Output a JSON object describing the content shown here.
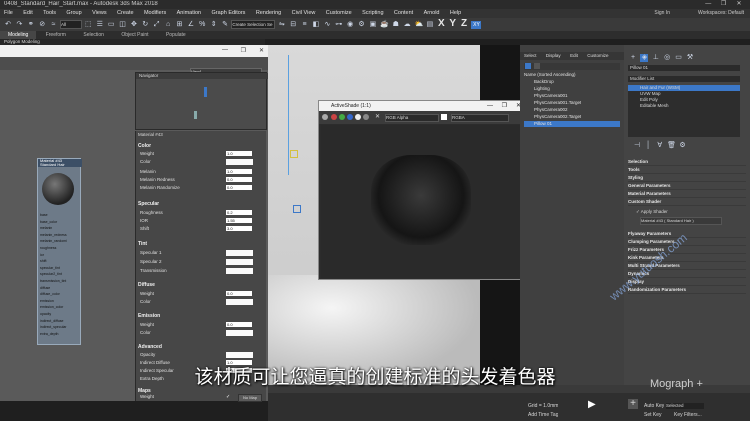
{
  "window": {
    "title": "0408_Standard_Hair_Start.max - Autodesk 3ds Max 2018",
    "buttons": [
      "—",
      "❐",
      "✕"
    ]
  },
  "menu": [
    "File",
    "Edit",
    "Tools",
    "Group",
    "Views",
    "Create",
    "Modifiers",
    "Animation",
    "Graph Editors",
    "Rendering",
    "Civil View",
    "Customize",
    "Scripting",
    "Content",
    "Arnold",
    "Help"
  ],
  "signin": "Sign In",
  "workspace": "Workspaces: Default",
  "toolbar": {
    "filter": "All",
    "selection_set": "Create Selection Se",
    "axes": [
      "X",
      "Y",
      "Z",
      "XY"
    ]
  },
  "ribbon": {
    "tabs": [
      "Modeling",
      "Freeform",
      "Selection",
      "Object Paint",
      "Populate"
    ],
    "sub": "Polygon Modeling"
  },
  "slate": {
    "view_select": "View1",
    "navigator": "Navigator",
    "panel_title": "Material #43",
    "groups": [
      {
        "name": "Color",
        "rows": [
          {
            "label": "Weight",
            "value": "1.0"
          },
          {
            "label": "Color",
            "value": ""
          },
          {
            "label": "Melanin",
            "value": "1.0"
          },
          {
            "label": "Melanin Redness",
            "value": "0.0"
          },
          {
            "label": "Melanin Randomize",
            "value": "0.0"
          }
        ]
      },
      {
        "name": "Specular",
        "rows": [
          {
            "label": "Roughness",
            "value": "0.2"
          },
          {
            "label": "IOR",
            "value": "1.55"
          },
          {
            "label": "Shift",
            "value": "3.0"
          }
        ]
      },
      {
        "name": "Tint",
        "rows": [
          {
            "label": "Specular 1",
            "value": ""
          },
          {
            "label": "Specular 2",
            "value": ""
          },
          {
            "label": "Transmission",
            "value": ""
          }
        ]
      },
      {
        "name": "Diffuse",
        "rows": [
          {
            "label": "Weight",
            "value": "0.0"
          },
          {
            "label": "Color",
            "value": ""
          }
        ]
      },
      {
        "name": "Emission",
        "rows": [
          {
            "label": "Weight",
            "value": "0.0"
          },
          {
            "label": "Color",
            "value": ""
          }
        ]
      },
      {
        "name": "Advanced",
        "rows": [
          {
            "label": "Opacity",
            "value": ""
          },
          {
            "label": "Indirect Diffuse",
            "value": "1.0"
          },
          {
            "label": "Indirect Specular",
            "value": "1.0"
          },
          {
            "label": "Extra Depth",
            "value": ""
          }
        ]
      },
      {
        "name": "Maps",
        "rows": [
          {
            "label": "Weight",
            "value": "No Map"
          },
          {
            "label": "Color",
            "value": "No Map"
          }
        ]
      }
    ],
    "node": {
      "title": "Material #43",
      "subtitle": "Standard Hair",
      "ports": [
        "base",
        "base_color",
        "melanin",
        "melanin_redness",
        "melanin_randomi",
        "roughness",
        "ior",
        "shift",
        "specular_tint",
        "specular2_tint",
        "transmission_tint",
        "diffuse",
        "diffuse_color",
        "emission",
        "emission_color",
        "opacity",
        "indirect_diffuse",
        "indirect_specular",
        "extra_depth"
      ]
    }
  },
  "activeshade": {
    "title": "ActiveShade (1:1)",
    "channel": "RGB Alpha",
    "mode": "RGBA"
  },
  "explorer": {
    "tabs": [
      "Select",
      "Display",
      "Edit",
      "Customize"
    ],
    "sort": "Name (Sorted Ascending)",
    "items": [
      "BackDrop",
      "Lighting",
      "PhysCamera001",
      "PhysCamera001.Target",
      "PhysCamera002",
      "PhysCamera002.Target",
      "Pillow 01"
    ]
  },
  "command": {
    "object_name": "Pillow 01",
    "modifier_list": "Modifier List",
    "stack": [
      "Hair and Fur (WSM)",
      "UVW Map",
      "Edit Poly",
      "Editable Mesh"
    ],
    "rollouts": [
      "Selection",
      "Tools",
      "Styling",
      "General Parameters",
      "Material Parameters",
      "Custom Shader",
      "Flyaway Parameters",
      "Clumping Parameters",
      "Frizz Parameters",
      "Kink Parameters",
      "Multi Strand Parameters",
      "Dynamics",
      "Display",
      "Randomization Parameters"
    ],
    "apply_shader": "Apply Shader",
    "shader_value": "Material #43 ( Standard Hair )"
  },
  "status": {
    "grid": "Grid = 1.0mm",
    "add_time_tag": "Add Time Tag",
    "auto_key": "Auto Key",
    "selected": "Selected",
    "set_key": "Set Key",
    "key_filters": "Key Filters..."
  },
  "subtitle": "该材质可让您逼真的创建标准的头发着色器",
  "watermark": "www.yutuosh.com",
  "mograph": "Mograph +",
  "colors": {
    "accent": "#3c78c8",
    "window": "#2b2b2b"
  }
}
